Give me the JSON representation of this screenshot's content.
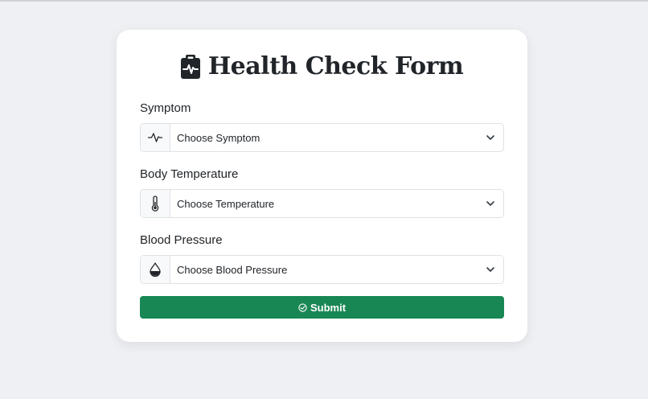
{
  "form": {
    "title": "Health Check Form",
    "title_icon": "clipboard-pulse-icon",
    "fields": [
      {
        "label": "Symptom",
        "icon": "activity-pulse-icon",
        "selected": "Choose Symptom"
      },
      {
        "label": "Body Temperature",
        "icon": "thermometer-icon",
        "selected": "Choose Temperature"
      },
      {
        "label": "Blood Pressure",
        "icon": "droplet-half-icon",
        "selected": "Choose Blood Pressure"
      }
    ],
    "submit_label": "Submit",
    "submit_icon": "check-circle-icon"
  },
  "colors": {
    "page_background": "#eef0f3",
    "card_background": "#ffffff",
    "submit_background": "#198754",
    "text": "#212529",
    "border": "#dee2e6"
  }
}
